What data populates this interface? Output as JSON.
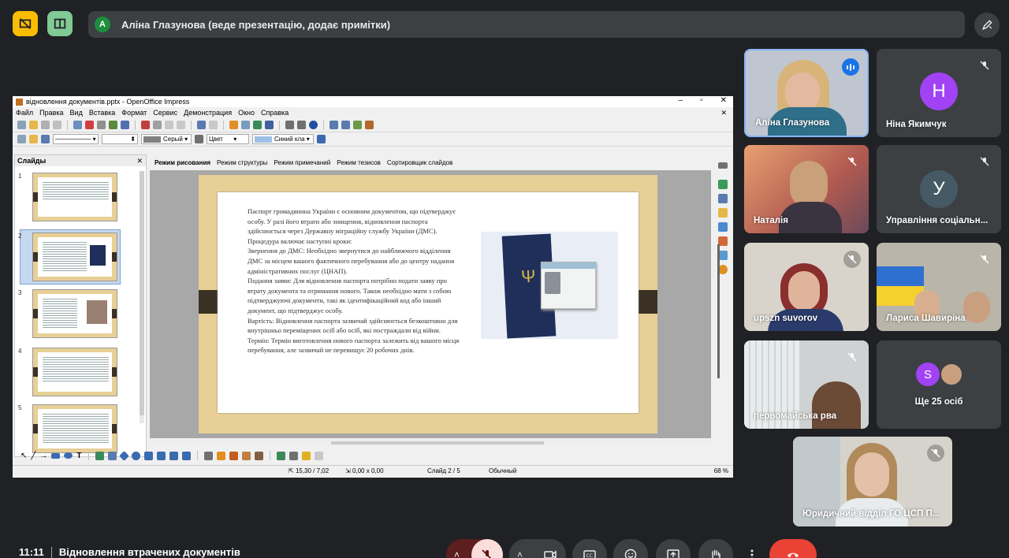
{
  "top_bar": {
    "presenter_initial": "A",
    "presenter_text": "Аліна Глазунова (веде презентацію, додає примітки)"
  },
  "impress": {
    "window_title": "відновлення документів.pptx - OpenOffice Impress",
    "menu": [
      "Файл",
      "Правка",
      "Вид",
      "Вставка",
      "Формат",
      "Сервис",
      "Демонстрация",
      "Окно",
      "Справка"
    ],
    "line_color": "Серый",
    "fill_mode": "Цвет",
    "fill_color": "Синий кла",
    "slides_panel_title": "Слайды",
    "slide_numbers": [
      "1",
      "2",
      "3",
      "4",
      "5"
    ],
    "view_tabs": [
      "Режим рисования",
      "Режим структуры",
      "Режим примечаний",
      "Режим тезисов",
      "Сортировщик слайдов"
    ],
    "slide_text": [
      "Паспорт громадянина України є основним документом, що підтверджує особу. У разі його втрати або знищення, відновлення паспорта здійснюється через Державну міграційну службу України (ДМС). Процедура включає наступні кроки:",
      "Звернення до ДМС: Необхідно звернутися до найближчого відділення ДМС за місцем вашого фактичного перебування або до центру надання адміністративних послуг (ЦНАП).",
      "Подання заяви: Для відновлення паспорта потрібно подати заяву про втрату документа та отримання нового. Також необхідно мати з собою підтверджуючі документи, такі як ідентифікаційний код або інший документ, що підтверджує особу.",
      "Вартість: Відновлення паспорта зазвичай здійснюється безкоштовно для внутрішньо переміщених осіб або осіб, які постраждали від війни.",
      "Термін: Термін виготовлення нового паспорта залежить від вашого місця перебування, але зазвичай не перевищує 20 робочих днів."
    ],
    "status_position": "15,30 / 7,02",
    "status_size": "0,00 x 0,00",
    "status_slide": "Слайд 2 / 5",
    "status_layout": "Обычный",
    "status_zoom": "68 %"
  },
  "participants": [
    {
      "name": "Аліна Глазунова",
      "speaking": true
    },
    {
      "name": "Ніна Якимчук",
      "initial": "Н",
      "color": "#a142f4"
    },
    {
      "name": "Наталія"
    },
    {
      "name": "Управління соціальн...",
      "initial": "У",
      "color": "#455a64"
    },
    {
      "name": "upszn suvorov"
    },
    {
      "name": "Лариса Шавиріна"
    },
    {
      "name": "первомайська рва"
    },
    {
      "name": "Ще 25 осіб",
      "initial": "S",
      "color": "#a142f4"
    },
    {
      "name": "Юридичний відділ ГО ЦСП П..."
    }
  ],
  "bottom": {
    "time": "11:11",
    "meeting_title": "Відновлення втрачених документів"
  },
  "colors": {
    "background": "#202124",
    "tile": "#3c4043",
    "accent_blue": "#1a73e8",
    "end_call": "#ea4335",
    "mic_off": "#f28b82",
    "yellow_btn": "#fbbc04",
    "green_btn": "#81c995"
  }
}
